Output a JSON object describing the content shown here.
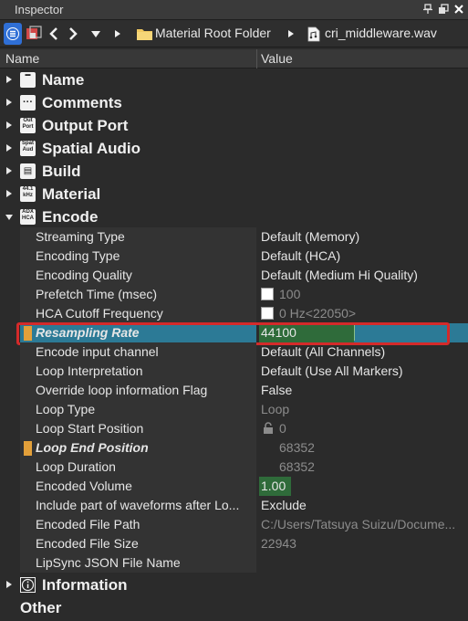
{
  "window": {
    "title": "Inspector"
  },
  "toolbar": {
    "breadcrumb_folder": "Material Root Folder",
    "breadcrumb_file": "cri_middleware.wav"
  },
  "header": {
    "name_col": "Name",
    "value_col": "Value"
  },
  "categories": {
    "name": "Name",
    "comments": "Comments",
    "output_port": "Output Port",
    "spatial_audio": "Spatial Audio",
    "build": "Build",
    "material": "Material",
    "encode": "Encode",
    "information": "Information",
    "other": "Other"
  },
  "rows": [
    {
      "name": "Streaming Type",
      "value": "Default (Memory)"
    },
    {
      "name": "Encoding Type",
      "value": "Default (HCA)"
    },
    {
      "name": "Encoding Quality",
      "value": "Default (Medium Hi Quality)"
    },
    {
      "name": "Prefetch Time (msec)",
      "value": "100"
    },
    {
      "name": "HCA Cutoff Frequency",
      "value": "0 Hz<22050>"
    },
    {
      "name": "Resampling Rate",
      "value": "44100"
    },
    {
      "name": "Encode input channel",
      "value": "Default (All Channels)"
    },
    {
      "name": "Loop Interpretation",
      "value": "Default (Use All Markers)"
    },
    {
      "name": "Override loop information Flag",
      "value": "False"
    },
    {
      "name": "Loop Type",
      "value": "Loop"
    },
    {
      "name": "Loop Start Position",
      "value": "0"
    },
    {
      "name": "Loop End Position",
      "value": "68352"
    },
    {
      "name": "Loop Duration",
      "value": "68352"
    },
    {
      "name": "Encoded Volume",
      "value": "1.00"
    },
    {
      "name": "Include part of waveforms after Lo...",
      "value": "Exclude"
    },
    {
      "name": "Encoded File Path",
      "value": "C:/Users/Tatsuya Suizu/Docume..."
    },
    {
      "name": "Encoded File Size",
      "value": "22943"
    },
    {
      "name": "LipSync JSON File Name",
      "value": ""
    }
  ],
  "colors": {
    "selected_row": "#2c7a96",
    "value_bar_green": "#2f6b3a",
    "marker_orange": "#e3a03a",
    "highlight_red": "#d42a2a"
  }
}
